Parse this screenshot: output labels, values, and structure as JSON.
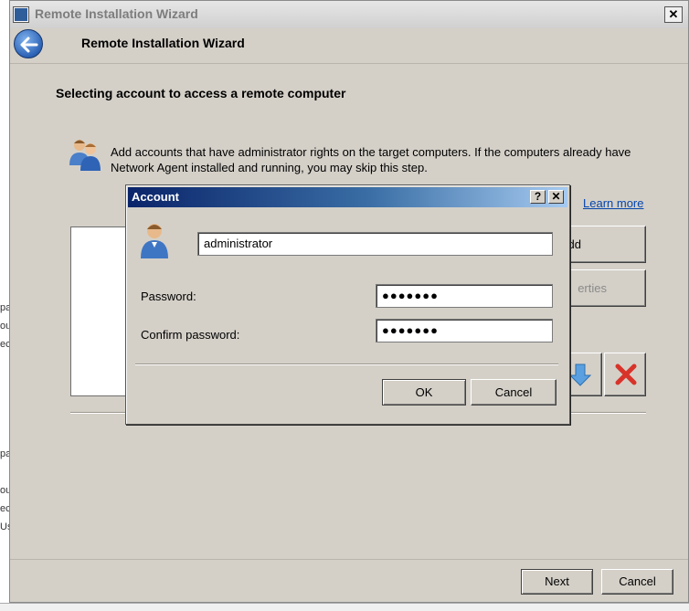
{
  "background_fragments": [
    "pa",
    "ou",
    "ec",
    "pa",
    "ou",
    "ec",
    "Us"
  ],
  "wizard": {
    "window_title": "Remote Installation Wizard",
    "close_glyph": "✕",
    "header_title": "Remote Installation Wizard",
    "page_heading": "Selecting account to access a remote computer",
    "info_text": "Add accounts that have administrator rights on the target computers. If the computers already have Network Agent installed and running, you may skip this step.",
    "learn_more": "Learn more",
    "add_button_visible": "dd",
    "properties_button_visible": "erties",
    "next_label": "Next",
    "cancel_label": "Cancel"
  },
  "dialog": {
    "title": "Account",
    "help_glyph": "?",
    "close_glyph": "✕",
    "username_value": "administrator",
    "password_label": "Password:",
    "password_value": "●●●●●●●",
    "confirm_label": "Confirm password:",
    "confirm_value": "●●●●●●●",
    "ok_label": "OK",
    "cancel_label": "Cancel"
  },
  "icons": {
    "back": "back-arrow-icon",
    "users": "users-icon",
    "user": "user-icon",
    "down": "down-arrow-icon",
    "delete": "delete-x-icon"
  },
  "colors": {
    "dialog_title_start": "#0a246a",
    "dialog_title_end": "#a6caf0",
    "link": "#0645ad",
    "delete_red": "#d8332a"
  }
}
